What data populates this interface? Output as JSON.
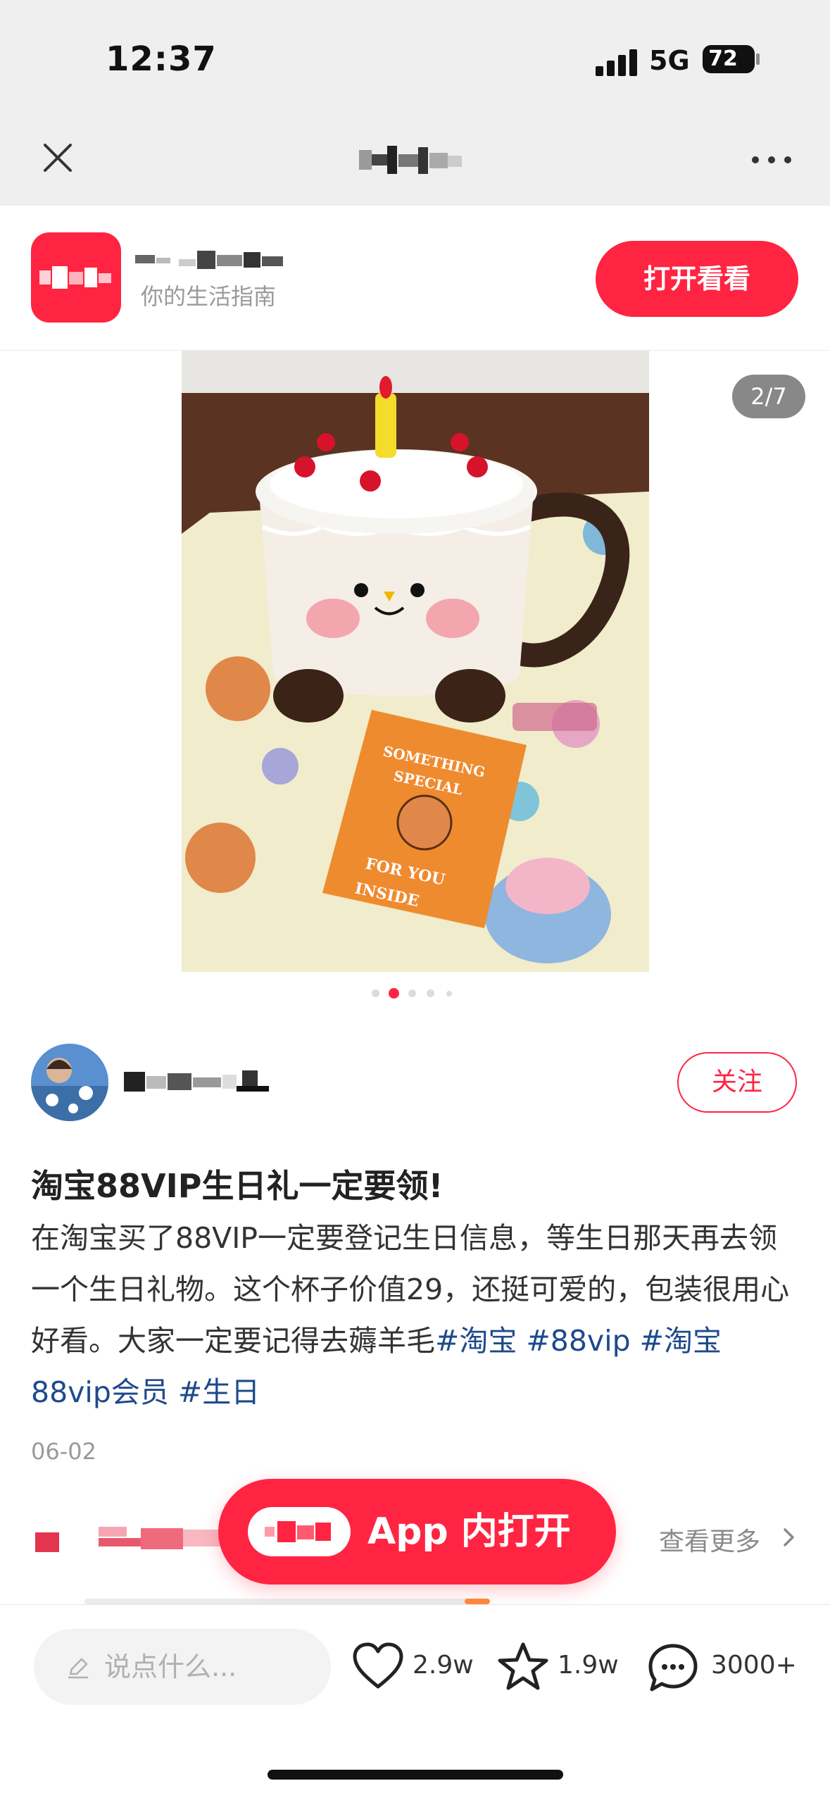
{
  "status_bar": {
    "time": "12:37",
    "network": "5G",
    "battery": "72"
  },
  "nav": {
    "close_icon": "close-icon",
    "more_icon": "more-dots-icon"
  },
  "banner": {
    "subtitle": "你的生活指南",
    "open_button": "打开看看",
    "accent_color": "#ff2442"
  },
  "carousel": {
    "page_indicator": "2/7",
    "current_index": 2,
    "total_dots": 5
  },
  "author": {
    "follow_label": "关注"
  },
  "post": {
    "title": "淘宝88VIP生日礼一定要领!",
    "body": "在淘宝买了88VIP一定要登记生日信息，等生日那天再去领一个生日礼物。这个杯子价值29，还挺可爱的，包装很用心好看。大家一定要记得去薅羊毛",
    "tags": [
      "#淘宝",
      "#88vip",
      "#淘宝88vip会员",
      "#生日"
    ],
    "date": "06-02"
  },
  "more_section": {
    "link_label": "查看更多"
  },
  "floating_button": {
    "label": "App 内打开"
  },
  "bottom_bar": {
    "comment_placeholder": "说点什么...",
    "likes": "2.9w",
    "favorites": "1.9w",
    "comments": "3000+"
  }
}
